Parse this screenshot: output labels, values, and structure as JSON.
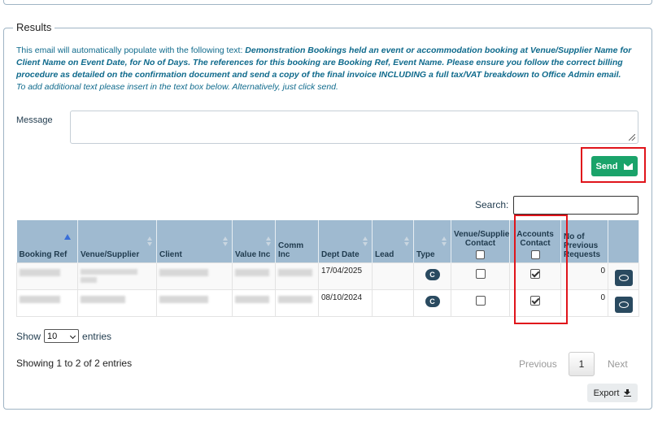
{
  "section": {
    "legend": "Results"
  },
  "info": {
    "intro": "This email will automatically populate with the following text: ",
    "template": "Demonstration Bookings held an event or accommodation booking at Venue/Supplier Name for Client Name on Event Date, for No of Days. The references for this booking are Booking Ref, Event Name. Please ensure you follow the correct billing procedure as detailed on the confirmation document and send a copy of the final invoice INCLUDING a full tax/VAT breakdown to Office Admin email.",
    "hint": "To add additional text please insert in the text box below. Alternatively, just click send."
  },
  "message": {
    "label": "Message",
    "value": "",
    "placeholder": ""
  },
  "send": {
    "label": "Send",
    "icon": "envelope-icon",
    "color": "#1aa36a"
  },
  "search": {
    "label": "Search:",
    "value": ""
  },
  "table": {
    "columns": [
      "Booking Ref",
      "Venue/Supplier",
      "Client",
      "Value Inc",
      "Comm Inc",
      "Dept Date",
      "Lead",
      "Type",
      "Venue/Supplier Contact",
      "Accounts Contact",
      "No of Previous Requests",
      ""
    ],
    "rows": [
      {
        "dept_date": "17/04/2025",
        "type": "C",
        "venue_contact": false,
        "accounts_contact": true,
        "previous_requests": "0"
      },
      {
        "dept_date": "08/10/2024",
        "type": "C",
        "venue_contact": false,
        "accounts_contact": true,
        "previous_requests": "0"
      }
    ]
  },
  "length": {
    "show_label": "Show",
    "selected": "10",
    "entries_label": "entries"
  },
  "info_footer": "Showing 1 to 2 of 2 entries",
  "pager": {
    "previous": "Previous",
    "page": "1",
    "next": "Next"
  },
  "export": {
    "label": "Export",
    "icon": "download-icon"
  },
  "colors": {
    "highlight": "#e0141b",
    "header": "#9fbad0",
    "badge": "#2a4a60"
  }
}
